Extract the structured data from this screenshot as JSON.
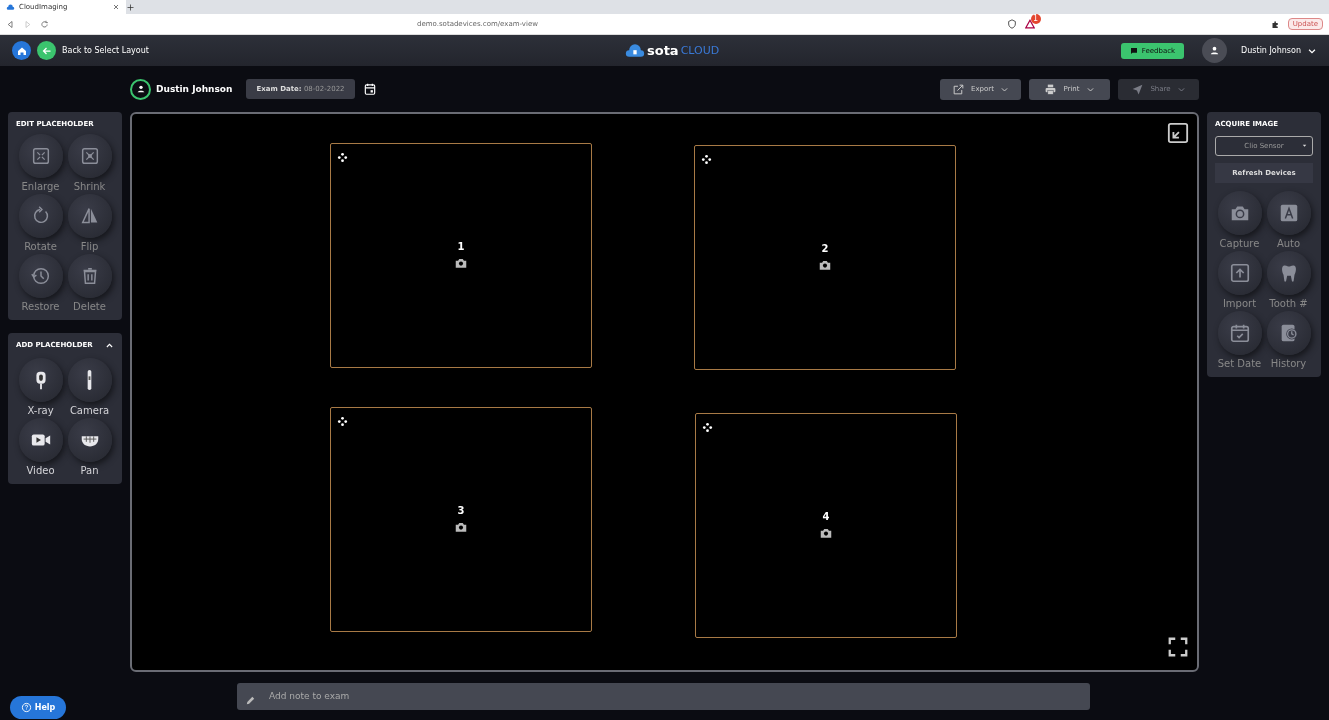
{
  "browser": {
    "tab_title": "CloudImaging",
    "url": "demo.sotadevices.com/exam-view",
    "alert_count": "1",
    "update_label": "Update"
  },
  "header": {
    "back_label": "Back to Select Layout",
    "logo_main": "sota",
    "logo_accent": "CLOUD",
    "feedback_label": "Feedback",
    "user_name": "Dustin Johnson"
  },
  "exam": {
    "patient_name": "Dustin Johnson",
    "date_label": "Exam Date:",
    "date_value": "08-02-2022"
  },
  "actions": [
    {
      "label": "Export",
      "disabled": false
    },
    {
      "label": "Print",
      "disabled": false
    },
    {
      "label": "Share",
      "disabled": true
    }
  ],
  "edit_placeholder": {
    "title": "EDIT PLACEHOLDER",
    "tools": [
      {
        "label": "Enlarge"
      },
      {
        "label": "Shrink"
      },
      {
        "label": "Rotate"
      },
      {
        "label": "Flip"
      },
      {
        "label": "Restore"
      },
      {
        "label": "Delete"
      }
    ]
  },
  "add_placeholder": {
    "title": "ADD PLACEHOLDER",
    "expanded": true,
    "tools": [
      {
        "label": "X-ray"
      },
      {
        "label": "Camera"
      },
      {
        "label": "Video"
      },
      {
        "label": "Pan"
      }
    ]
  },
  "placeholders": [
    {
      "number": "1"
    },
    {
      "number": "2"
    },
    {
      "number": "3"
    },
    {
      "number": "4"
    }
  ],
  "acquire_image": {
    "title": "ACQUIRE IMAGE",
    "device": "Clio Sensor",
    "refresh_label": "Refresh Devices",
    "tools": [
      {
        "label": "Capture"
      },
      {
        "label": "Auto"
      },
      {
        "label": "Import"
      },
      {
        "label": "Tooth #"
      },
      {
        "label": "Set Date"
      },
      {
        "label": "History"
      }
    ]
  },
  "note": {
    "placeholder": "Add note to exam"
  },
  "help_label": "Help"
}
